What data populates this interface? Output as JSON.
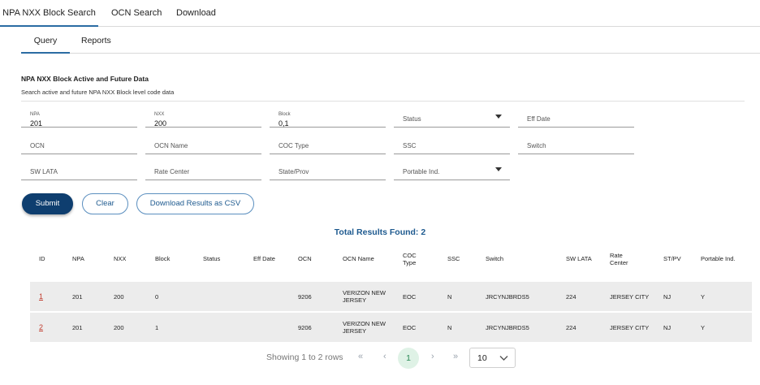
{
  "top_tabs": [
    {
      "label": "NPA NXX Block Search"
    },
    {
      "label": "OCN Search"
    },
    {
      "label": "Download"
    }
  ],
  "sub_tabs": [
    {
      "label": "Query"
    },
    {
      "label": "Reports"
    }
  ],
  "section": {
    "title": "NPA NXX Block Active and Future Data",
    "subtitle": "Search active and future NPA NXX Block level code data"
  },
  "form": {
    "npa": {
      "label": "NPA",
      "value": "201"
    },
    "nxx": {
      "label": "NXX",
      "value": "200"
    },
    "block": {
      "label": "Block",
      "value": "0,1"
    },
    "status": {
      "placeholder": "Status"
    },
    "eff_date": {
      "placeholder": "Eff Date"
    },
    "ocn": {
      "placeholder": "OCN"
    },
    "ocn_name": {
      "placeholder": "OCN Name"
    },
    "coc_type": {
      "placeholder": "COC Type"
    },
    "ssc": {
      "placeholder": "SSC"
    },
    "switch": {
      "placeholder": "Switch"
    },
    "sw_lata": {
      "placeholder": "SW LATA"
    },
    "rate_center": {
      "placeholder": "Rate Center"
    },
    "state_prov": {
      "placeholder": "State/Prov"
    },
    "portable_ind": {
      "placeholder": "Portable Ind."
    }
  },
  "buttons": {
    "submit": "Submit",
    "clear": "Clear",
    "download": "Download Results as CSV"
  },
  "results": {
    "total_label": "Total Results Found: 2"
  },
  "table": {
    "headers": [
      "ID",
      "NPA",
      "NXX",
      "Block",
      "Status",
      "Eff Date",
      "OCN",
      "OCN Name",
      "COC\nType",
      "SSC",
      "Switch",
      "SW LATA",
      "Rate\nCenter",
      "ST/PV",
      "Portable Ind."
    ],
    "rows": [
      [
        "1",
        "201",
        "200",
        "0",
        "",
        "",
        "9206",
        "VERIZON NEW\nJERSEY",
        "EOC",
        "N",
        "JRCYNJBRDS5",
        "224",
        "JERSEY CITY",
        "NJ",
        "Y"
      ],
      [
        "2",
        "201",
        "200",
        "1",
        "",
        "",
        "9206",
        "VERIZON NEW\nJERSEY",
        "EOC",
        "N",
        "JRCYNJBRDS5",
        "224",
        "JERSEY CITY",
        "NJ",
        "Y"
      ]
    ]
  },
  "pagination": {
    "showing": "Showing 1 to 2 rows",
    "first": "«",
    "prev": "‹",
    "current": "1",
    "next": "›",
    "last": "»",
    "page_size": "10"
  },
  "colors": {
    "primary": "#0e3e6f",
    "accent": "#1e5a8f",
    "link": "#c0392b",
    "row_bg": "#ececec"
  }
}
